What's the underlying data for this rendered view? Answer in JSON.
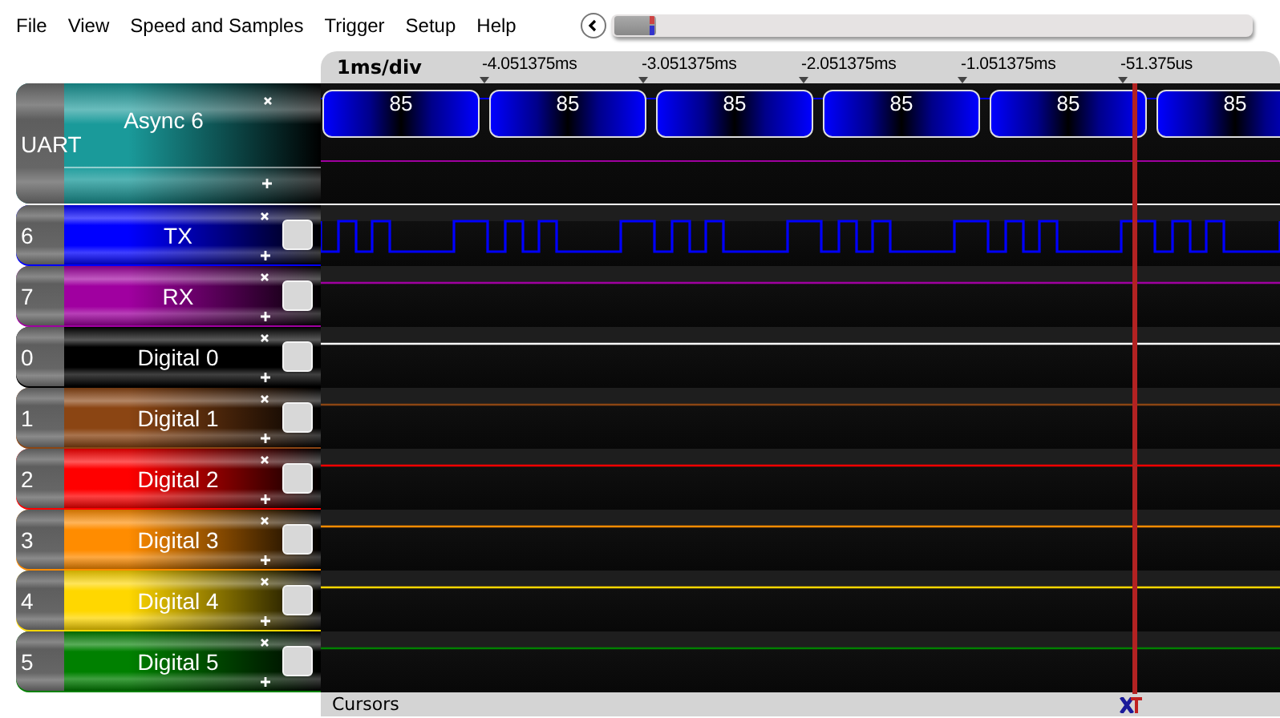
{
  "menu": [
    "File",
    "View",
    "Speed and Samples",
    "Trigger",
    "Setup",
    "Help"
  ],
  "timeline": {
    "scale": "1ms/div",
    "ticks": [
      "-4.051375ms",
      "-3.051375ms",
      "-2.051375ms",
      "-1.051375ms",
      "-51.375us"
    ]
  },
  "analyzers": [
    {
      "group": "UART",
      "name": "Async 6",
      "color": "#1a9a9a",
      "decoded": [
        "85",
        "85",
        "85",
        "85",
        "85",
        "85"
      ]
    }
  ],
  "channels": [
    {
      "number": "6",
      "name": "TX",
      "color": "#0000ff",
      "checked": false,
      "kind": "pulses"
    },
    {
      "number": "7",
      "name": "RX",
      "color": "#a000a0",
      "checked": false,
      "kind": "flat"
    },
    {
      "number": "0",
      "name": "Digital 0",
      "color": "#000000",
      "checked": false,
      "kind": "flat"
    },
    {
      "number": "1",
      "name": "Digital 1",
      "color": "#8b4513",
      "checked": false,
      "kind": "flat"
    },
    {
      "number": "2",
      "name": "Digital 2",
      "color": "#ff0000",
      "checked": false,
      "kind": "flat"
    },
    {
      "number": "3",
      "name": "Digital 3",
      "color": "#ff8c00",
      "checked": false,
      "kind": "flat"
    },
    {
      "number": "4",
      "name": "Digital 4",
      "color": "#ffd700",
      "checked": false,
      "kind": "flat"
    },
    {
      "number": "5",
      "name": "Digital 5",
      "color": "#008000",
      "checked": false,
      "kind": "flat"
    }
  ],
  "cursors": {
    "label": "Cursors"
  }
}
